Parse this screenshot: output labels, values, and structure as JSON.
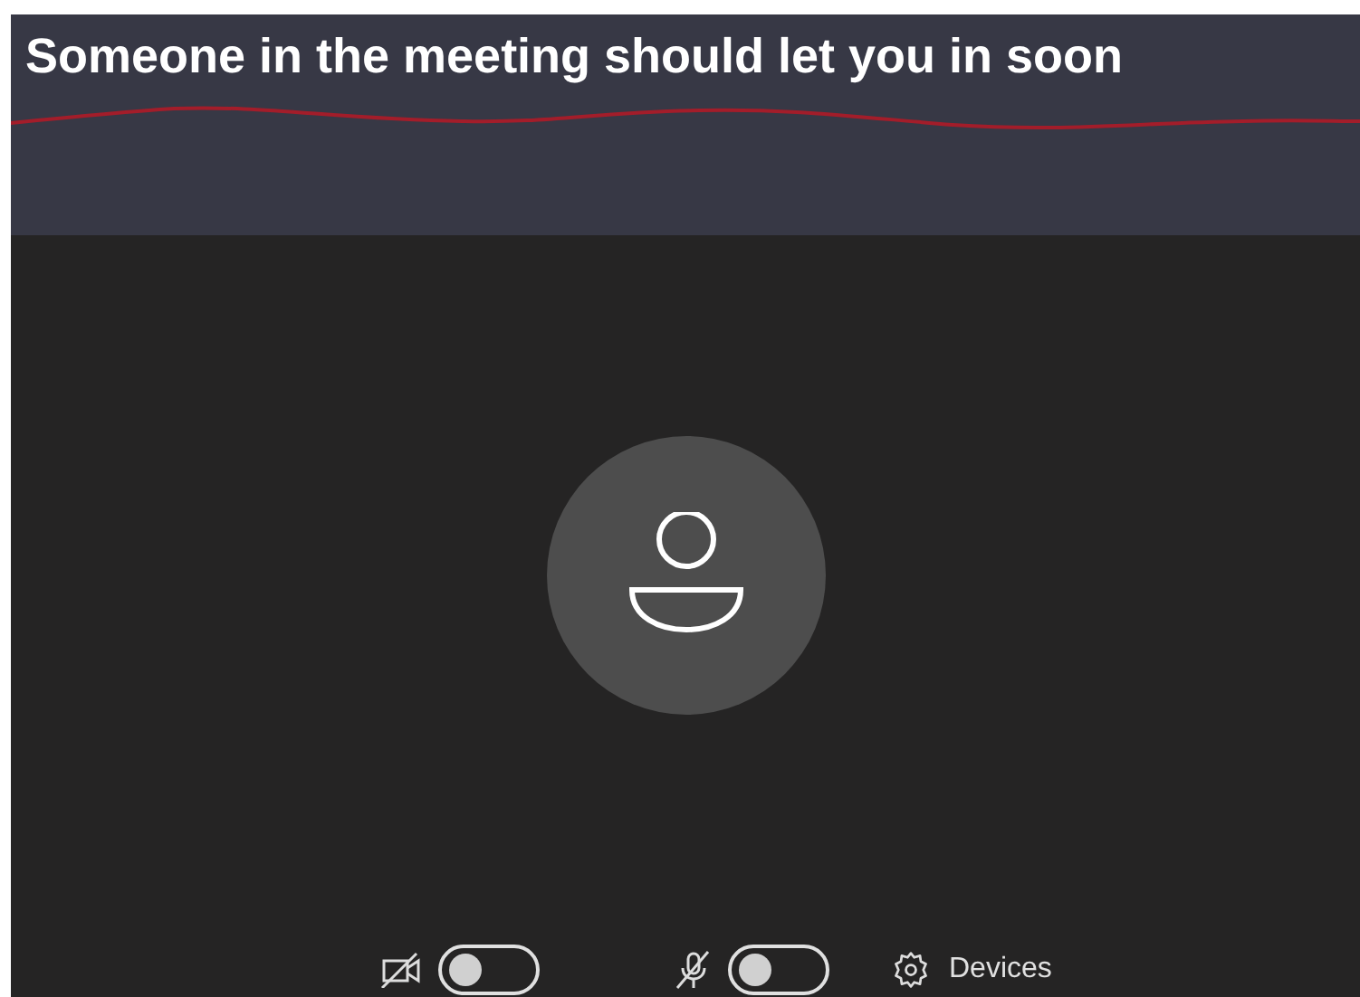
{
  "header": {
    "title": "Someone in the meeting should let you in soon"
  },
  "controls": [
    {
      "kind": "camera",
      "on": false
    },
    {
      "kind": "microphone",
      "on": false
    }
  ],
  "devices_button": {
    "label": "Devices"
  }
}
